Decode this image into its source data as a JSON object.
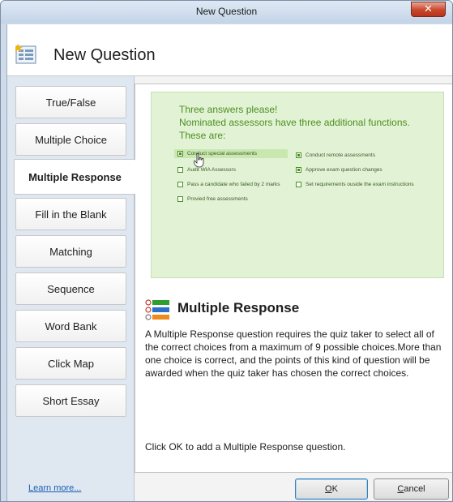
{
  "window": {
    "title": "New Question",
    "close_glyph": "✕"
  },
  "header": {
    "title": "New Question",
    "icon": "new-question-icon"
  },
  "sidebar": {
    "items": [
      {
        "label": "True/False",
        "selected": false
      },
      {
        "label": "Multiple Choice",
        "selected": false
      },
      {
        "label": "Multiple Response",
        "selected": true
      },
      {
        "label": "Fill in the Blank",
        "selected": false
      },
      {
        "label": "Matching",
        "selected": false
      },
      {
        "label": "Sequence",
        "selected": false
      },
      {
        "label": "Word Bank",
        "selected": false
      },
      {
        "label": "Click Map",
        "selected": false
      },
      {
        "label": "Short Essay",
        "selected": false
      }
    ],
    "learn_more": "Learn more..."
  },
  "preview": {
    "line1": "Three answers please!",
    "line2": "Nominated assessors have three additional functions.",
    "line3": "These are:",
    "options": [
      {
        "label": "Conduct special assessments",
        "checked": true
      },
      {
        "label": "Audit WIA Assessors",
        "checked": false
      },
      {
        "label": "Pass a candidate who failed by 2 marks",
        "checked": false
      },
      {
        "label": "Provied free assessments",
        "checked": false
      },
      {
        "label": "Conduct remote assessments",
        "checked": true
      },
      {
        "label": "Approve exam question changes",
        "checked": true
      },
      {
        "label": "Set requirements ouside the exam instructions",
        "checked": false
      }
    ],
    "colors": {
      "accent": "#4b8e1f",
      "background": "#e2f3d5"
    }
  },
  "description": {
    "title": "Multiple Response",
    "text": "A Multiple Response question requires the quiz taker to select all of the correct choices from a maximum of 9 possible choices.More than one choice is correct, and the points of this kind of question will be awarded when the quiz taker has chosen the correct choices.",
    "footer": "Click OK to add a Multiple Response question.",
    "icon": "multiple-response-icon"
  },
  "buttons": {
    "ok_mnemonic": "O",
    "ok_rest": "K",
    "cancel_mnemonic": "C",
    "cancel_rest": "ancel"
  }
}
